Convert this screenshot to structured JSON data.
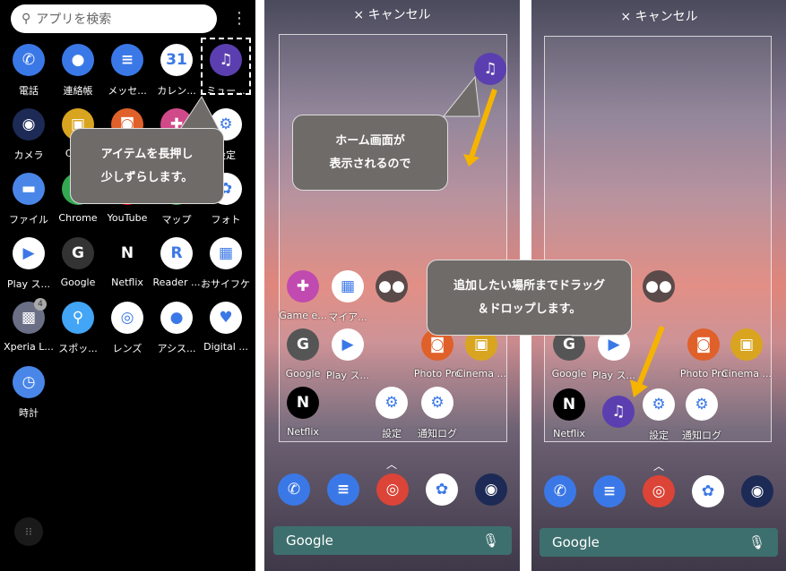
{
  "drawer": {
    "search_placeholder": "アプリを検索",
    "apps": [
      {
        "label": "電話",
        "icon": "phone-icon",
        "glyph": "✆",
        "color": "#3b78e7"
      },
      {
        "label": "連絡帳",
        "icon": "contacts-icon",
        "glyph": "●",
        "color": "#3b78e7"
      },
      {
        "label": "メッセ...",
        "icon": "messages-icon",
        "glyph": "≡",
        "color": "#3b78e7"
      },
      {
        "label": "カレン...",
        "icon": "calendar-icon",
        "glyph": "31",
        "color": "#ffffff"
      },
      {
        "label": "ミュー...",
        "icon": "music-icon",
        "glyph": "♫",
        "color": "#5b3fb0"
      },
      {
        "label": "カメラ",
        "icon": "camera-icon",
        "glyph": "◉",
        "color": "#1d2a55"
      },
      {
        "label": "Cin...",
        "icon": "cinema-icon",
        "glyph": "▣",
        "color": "#d9a520"
      },
      {
        "label": "",
        "icon": "photo-pro-icon",
        "glyph": "◙",
        "color": "#e0602a"
      },
      {
        "label": "",
        "icon": "game-icon",
        "glyph": "✚",
        "color": "#d04a8a"
      },
      {
        "label": "設定",
        "icon": "settings-icon",
        "glyph": "⚙",
        "color": "#ffffff"
      },
      {
        "label": "ファイル",
        "icon": "files-icon",
        "glyph": "▬",
        "color": "#4a86e8"
      },
      {
        "label": "Chrome",
        "icon": "chrome-icon",
        "glyph": "◎",
        "color": "#34a853"
      },
      {
        "label": "YouTube",
        "icon": "youtube-icon",
        "glyph": "▶",
        "color": "#ff0000"
      },
      {
        "label": "マップ",
        "icon": "maps-icon",
        "glyph": "◆",
        "color": "#34a853"
      },
      {
        "label": "フォト",
        "icon": "photos-icon",
        "glyph": "✿",
        "color": "#ffffff"
      },
      {
        "label": "Play ス...",
        "icon": "play-store-icon",
        "glyph": "▶",
        "color": "#ffffff"
      },
      {
        "label": "Google",
        "icon": "google-folder-icon",
        "glyph": "G",
        "color": "#333333"
      },
      {
        "label": "Netflix",
        "icon": "netflix-icon",
        "glyph": "N",
        "color": "#000000"
      },
      {
        "label": "Reader ...",
        "icon": "reader-icon",
        "glyph": "R",
        "color": "#ffffff"
      },
      {
        "label": "おサイフケー...",
        "icon": "osaifu-icon",
        "glyph": "▦",
        "color": "#ffffff"
      },
      {
        "label": "Xperia L...",
        "icon": "xperia-lounge-icon",
        "glyph": "▩",
        "color": "#6b6f86",
        "badge": "4"
      },
      {
        "label": "スポッ...",
        "icon": "spot-icon",
        "glyph": "⚲",
        "color": "#42a5f5"
      },
      {
        "label": "レンズ",
        "icon": "lens-icon",
        "glyph": "◎",
        "color": "#ffffff"
      },
      {
        "label": "アシス...",
        "icon": "assistant-icon",
        "glyph": "●",
        "color": "#ffffff"
      },
      {
        "label": "Digital ...",
        "icon": "digital-wellbeing-icon",
        "glyph": "♥",
        "color": "#ffffff"
      },
      {
        "label": "時計",
        "icon": "clock-icon",
        "glyph": "◷",
        "color": "#4a86e8"
      }
    ],
    "callout": [
      "アイテムを長押し",
      "少しずらします。"
    ]
  },
  "home1": {
    "cancel": "× キャンセル",
    "apps": [
      {
        "label": "Game e...",
        "icon": "game-enhancer-icon",
        "glyph": "✚",
        "color": "#c04ab0"
      },
      {
        "label": "マイア...",
        "icon": "my-apps-icon",
        "glyph": "▦",
        "color": "#ffffff"
      },
      {
        "label": "",
        "icon": "google-folder-icon",
        "glyph": "●●",
        "color": "#5a4a4a"
      },
      {
        "label": "Google",
        "icon": "google-folder-icon",
        "glyph": "G",
        "color": "#555555"
      },
      {
        "label": "Play ス...",
        "icon": "play-store-icon",
        "glyph": "▶",
        "color": "#ffffff"
      },
      {
        "label": "Photo Pro",
        "icon": "photo-pro-icon",
        "glyph": "◙",
        "color": "#e0602a"
      },
      {
        "label": "Cinema ...",
        "icon": "cinema-icon",
        "glyph": "▣",
        "color": "#d9a520"
      },
      {
        "label": "Netflix",
        "icon": "netflix-icon",
        "glyph": "N",
        "color": "#000000"
      },
      {
        "label": "設定",
        "icon": "settings-icon",
        "glyph": "⚙",
        "color": "#ffffff"
      },
      {
        "label": "通知ログ",
        "icon": "notification-log-icon",
        "glyph": "⚙",
        "color": "#ffffff"
      }
    ],
    "callout": [
      "ホーム画面が",
      "表示されるので"
    ]
  },
  "home2": {
    "cancel": "× キャンセル",
    "apps": [
      {
        "label": "",
        "icon": "google-folder-icon",
        "glyph": "●●",
        "color": "#5a4a4a"
      },
      {
        "label": "Google",
        "icon": "google-folder-icon",
        "glyph": "G",
        "color": "#555555"
      },
      {
        "label": "Play ス...",
        "icon": "play-store-icon",
        "glyph": "▶",
        "color": "#ffffff"
      },
      {
        "label": "Photo Pro",
        "icon": "photo-pro-icon",
        "glyph": "◙",
        "color": "#e0602a"
      },
      {
        "label": "Cinema ...",
        "icon": "cinema-icon",
        "glyph": "▣",
        "color": "#d9a520"
      },
      {
        "label": "Netflix",
        "icon": "netflix-icon",
        "glyph": "N",
        "color": "#000000"
      },
      {
        "label": "設定",
        "icon": "settings-icon",
        "glyph": "⚙",
        "color": "#ffffff"
      },
      {
        "label": "通知ログ",
        "icon": "notification-log-icon",
        "glyph": "⚙",
        "color": "#ffffff"
      }
    ],
    "callout": [
      "追加したい場所までドラッグ",
      "＆ドロップします。"
    ]
  },
  "dock": [
    {
      "icon": "phone-icon",
      "glyph": "✆",
      "color": "#3b78e7"
    },
    {
      "icon": "messages-icon",
      "glyph": "≡",
      "color": "#3b78e7"
    },
    {
      "icon": "chrome-icon",
      "glyph": "◎",
      "color": "#db4437"
    },
    {
      "icon": "photos-icon",
      "glyph": "✿",
      "color": "#ffffff"
    },
    {
      "icon": "camera-icon",
      "glyph": "◉",
      "color": "#1d2a55"
    }
  ],
  "google_bar": {
    "label": "Google",
    "mic": "mic-icon"
  },
  "music_glyph": "♫",
  "colors": {
    "arrow": "#f5b400",
    "callout": "#6f6b68",
    "music": "#5b3fb0"
  }
}
